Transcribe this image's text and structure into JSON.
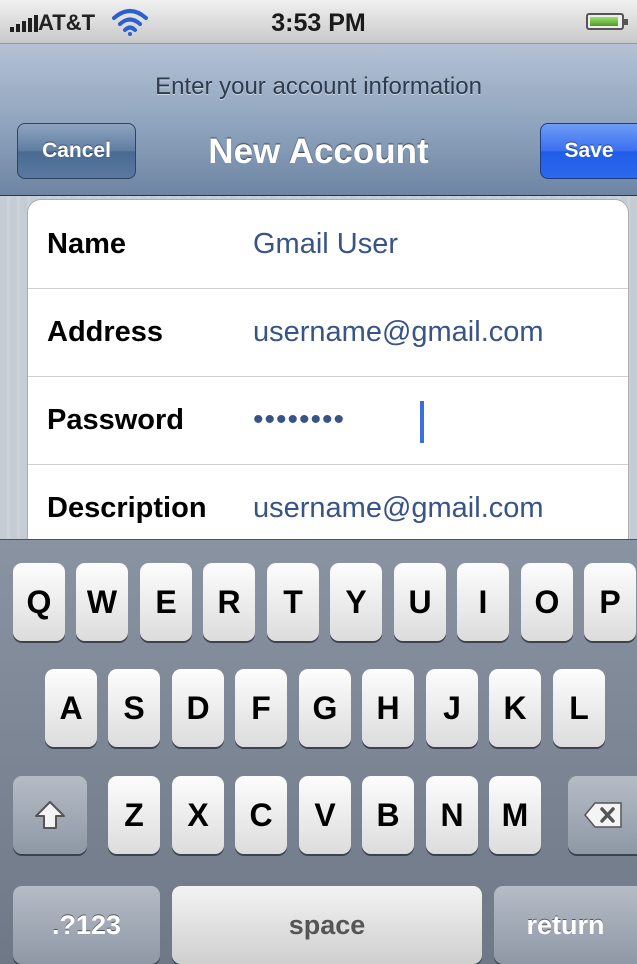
{
  "status_bar": {
    "carrier": "AT&T",
    "time": "3:53 PM"
  },
  "nav": {
    "prompt": "Enter your account information",
    "title": "New Account",
    "cancel_label": "Cancel",
    "save_label": "Save"
  },
  "form": {
    "rows": [
      {
        "label": "Name",
        "value": "Gmail User"
      },
      {
        "label": "Address",
        "value": "username@gmail.com"
      },
      {
        "label": "Password",
        "value": "••••••••"
      },
      {
        "label": "Description",
        "value": "username@gmail.com"
      }
    ]
  },
  "keyboard": {
    "row1": [
      "Q",
      "W",
      "E",
      "R",
      "T",
      "Y",
      "U",
      "I",
      "O",
      "P"
    ],
    "row2": [
      "A",
      "S",
      "D",
      "F",
      "G",
      "H",
      "J",
      "K",
      "L"
    ],
    "row3": [
      "Z",
      "X",
      "C",
      "V",
      "B",
      "N",
      "M"
    ],
    "numbers_label": ".?123",
    "space_label": "space",
    "return_label": "return"
  },
  "colors": {
    "field_value": "#385487",
    "save_button": "#2c68ec",
    "nav_bar": "#8ea3bd"
  },
  "icons": [
    "signal-icon",
    "wifi-icon",
    "battery-icon",
    "shift-icon",
    "backspace-icon"
  ]
}
